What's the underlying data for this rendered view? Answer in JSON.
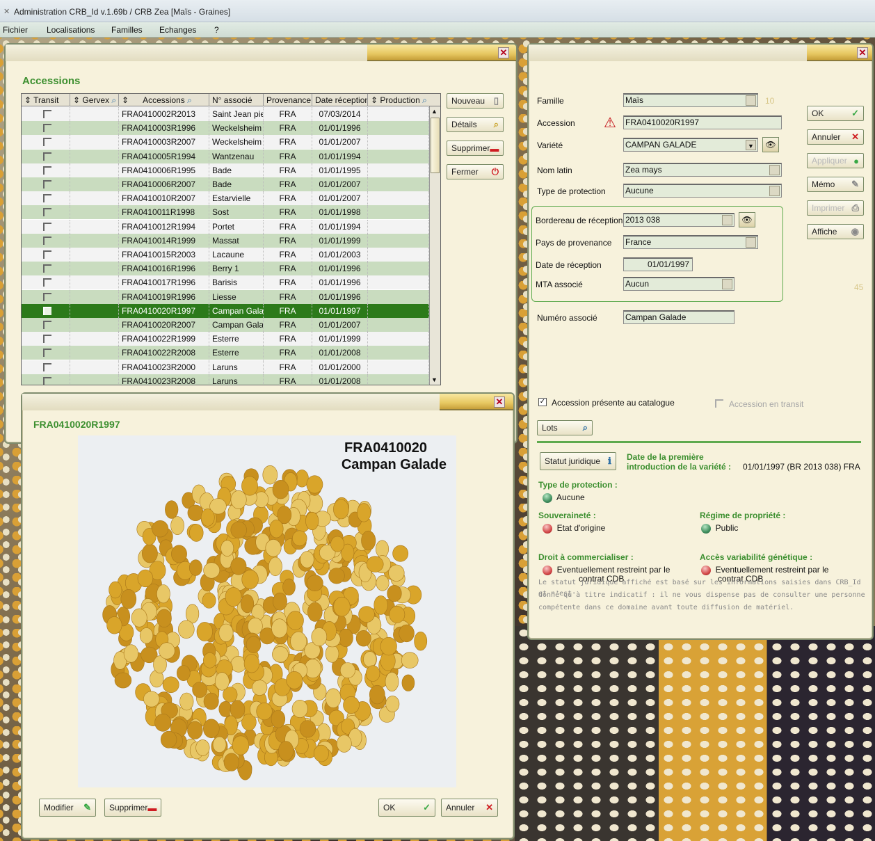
{
  "app": {
    "title": "Administration CRB_Id v.1.69b / CRB Zea [Maïs - Graines]",
    "menu": [
      "Fichier",
      "Localisations",
      "Familles",
      "Echanges",
      "?"
    ]
  },
  "accessions_window": {
    "title": "Accessions",
    "columns": [
      "Transit",
      "Gervex",
      "Accessions",
      "N° associé",
      "Provenance",
      "Date réception",
      "Production"
    ],
    "rows": [
      {
        "accession": "FRA0410002R2013",
        "associe": "Saint Jean pie",
        "provenance": "FRA",
        "date": "07/03/2014"
      },
      {
        "accession": "FRA0410003R1996",
        "associe": "Weckelsheim",
        "provenance": "FRA",
        "date": "01/01/1996"
      },
      {
        "accession": "FRA0410003R2007",
        "associe": "Weckelsheim",
        "provenance": "FRA",
        "date": "01/01/2007"
      },
      {
        "accession": "FRA0410005R1994",
        "associe": "Wantzenau",
        "provenance": "FRA",
        "date": "01/01/1994"
      },
      {
        "accession": "FRA0410006R1995",
        "associe": "Bade",
        "provenance": "FRA",
        "date": "01/01/1995"
      },
      {
        "accession": "FRA0410006R2007",
        "associe": "Bade",
        "provenance": "FRA",
        "date": "01/01/2007"
      },
      {
        "accession": "FRA0410010R2007",
        "associe": "Estarvielle",
        "provenance": "FRA",
        "date": "01/01/2007"
      },
      {
        "accession": "FRA0410011R1998",
        "associe": "Sost",
        "provenance": "FRA",
        "date": "01/01/1998"
      },
      {
        "accession": "FRA0410012R1994",
        "associe": "Portet",
        "provenance": "FRA",
        "date": "01/01/1994"
      },
      {
        "accession": "FRA0410014R1999",
        "associe": "Massat",
        "provenance": "FRA",
        "date": "01/01/1999"
      },
      {
        "accession": "FRA0410015R2003",
        "associe": "Lacaune",
        "provenance": "FRA",
        "date": "01/01/2003"
      },
      {
        "accession": "FRA0410016R1996",
        "associe": "Berry 1",
        "provenance": "FRA",
        "date": "01/01/1996"
      },
      {
        "accession": "FRA0410017R1996",
        "associe": "Barisis",
        "provenance": "FRA",
        "date": "01/01/1996"
      },
      {
        "accession": "FRA0410019R1996",
        "associe": "Liesse",
        "provenance": "FRA",
        "date": "01/01/1996"
      },
      {
        "accession": "FRA0410020R1997",
        "associe": "Campan Galac",
        "provenance": "FRA",
        "date": "01/01/1997"
      },
      {
        "accession": "FRA0410020R2007",
        "associe": "Campan Galac",
        "provenance": "FRA",
        "date": "01/01/2007"
      },
      {
        "accession": "FRA0410022R1999",
        "associe": "Esterre",
        "provenance": "FRA",
        "date": "01/01/1999"
      },
      {
        "accession": "FRA0410022R2008",
        "associe": "Esterre",
        "provenance": "FRA",
        "date": "01/01/2008"
      },
      {
        "accession": "FRA0410023R2000",
        "associe": "Laruns",
        "provenance": "FRA",
        "date": "01/01/2000"
      },
      {
        "accession": "FRA0410023R2008",
        "associe": "Laruns",
        "provenance": "FRA",
        "date": "01/01/2008"
      }
    ],
    "selected_index": 14,
    "buttons": {
      "nouveau": "Nouveau",
      "details": "Détails",
      "supprimer": "Supprimer",
      "fermer": "Fermer"
    }
  },
  "detail_window": {
    "famille_label": "Famille",
    "famille_value": "Maïs",
    "famille_num": "10",
    "accession_label": "Accession",
    "accession_value": "FRA0410020R1997",
    "variete_label": "Variété",
    "variete_value": "CAMPAN GALADE",
    "nomlatin_label": "Nom latin",
    "nomlatin_value": "Zea mays",
    "typeprot_label": "Type de protection",
    "typeprot_value": "Aucune",
    "bordereau_label": "Bordereau de réception",
    "bordereau_value": "2013 038",
    "pays_label": "Pays de provenance",
    "pays_value": "France",
    "date_label": "Date de réception",
    "date_value": "01/01/1997",
    "mta_label": "MTA associé",
    "mta_value": "Aucun",
    "mta_num": "45",
    "numero_label": "Numéro associé",
    "numero_value": "Campan Galade",
    "catalogue_label": "Accession présente au catalogue",
    "catalogue_checked": true,
    "transit_label": "Accession en transit",
    "lots_label": "Lots",
    "statut_button": "Statut juridique",
    "premiere_title_1": "Date de la première",
    "premiere_title_2": "introduction de la variété :",
    "premiere_value": "01/01/1997 (BR 2013 038) FRA",
    "type_prot_title": "Type de protection :",
    "type_prot_status": "Aucune",
    "souverainete_title": "Souveraineté :",
    "souverainete_value": "Etat d'origine",
    "regime_title": "Régime de propriété :",
    "regime_value": "Public",
    "droit_title": "Droit à commercialiser :",
    "droit_value_1": "Eventuellement restreint par le",
    "droit_value_2": "contrat CDB",
    "acces_title": "Accès variabilité génétique :",
    "acces_value_1": "Eventuellement restreint par le",
    "acces_value_2": "contrat CDB",
    "note_1": "Le statut juridique affiché est basé sur les informations saisies dans CRB_Id et n'est",
    "note_2": "donné qu'à titre indicatif : il ne vous dispense pas de consulter une personne",
    "note_3": "compétente dans ce domaine avant toute diffusion de matériel.",
    "buttons": {
      "ok": "OK",
      "annuler": "Annuler",
      "appliquer": "Appliquer",
      "memo": "Mémo",
      "imprimer": "Imprimer",
      "affiche": "Affiche"
    }
  },
  "photo_window": {
    "title": "FRA0410020R1997",
    "caption_1": "FRA0410020",
    "caption_2": "Campan Galade",
    "buttons": {
      "modifier": "Modifier",
      "supprimer": "Supprimer",
      "ok": "OK",
      "annuler": "Annuler"
    }
  }
}
